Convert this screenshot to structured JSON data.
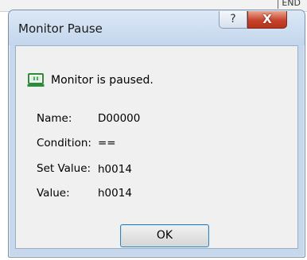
{
  "background": {
    "label": "END"
  },
  "dialog": {
    "title": "Monitor Pause",
    "help_glyph": "?",
    "close_glyph": "X",
    "message": "Monitor is paused.",
    "fields": [
      {
        "label": "Name:",
        "value": "D00000"
      },
      {
        "label": "Condition:",
        "value": "=="
      },
      {
        "label": "Set Value:",
        "value": "h0014"
      },
      {
        "label": "Value:",
        "value": "h0014"
      }
    ],
    "ok_label": "OK"
  },
  "colors": {
    "title_bar": "#c4d6ec",
    "close_button": "#c7432c",
    "ok_border": "#3c7fb1",
    "icon_green": "#2e8b3a"
  }
}
